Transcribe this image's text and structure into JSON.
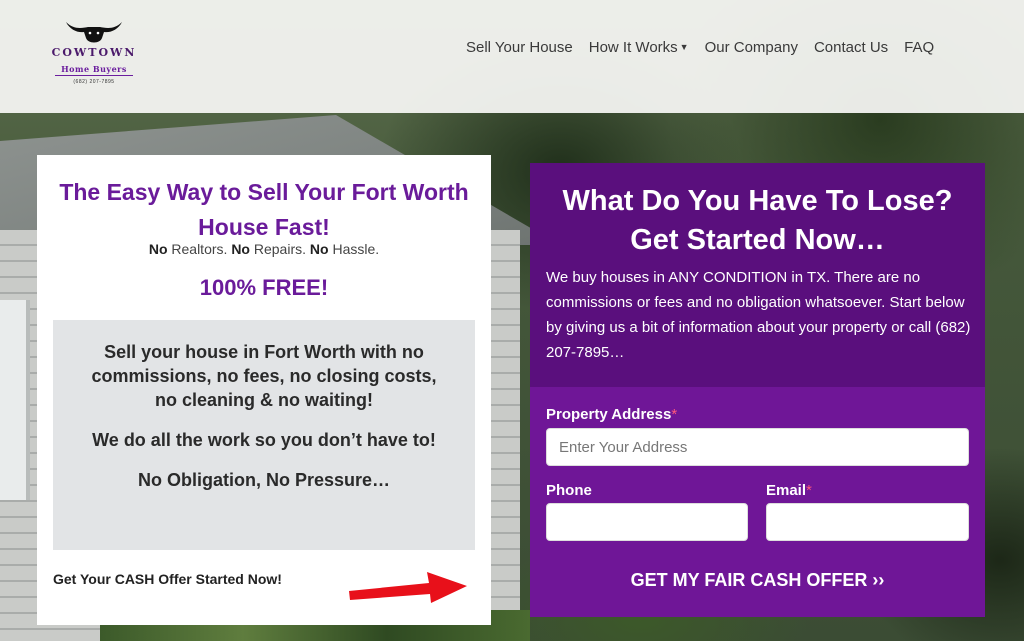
{
  "header": {
    "logo": {
      "name": "COWTOWN",
      "sub": "Home Buyers",
      "phone": "(682) 207-7895"
    },
    "nav": [
      {
        "label": "Sell Your House",
        "icon": ""
      },
      {
        "label": "How It Works",
        "icon": "caret-down-icon"
      },
      {
        "label": "Our Company",
        "icon": ""
      },
      {
        "label": "Contact Us",
        "icon": ""
      },
      {
        "label": "FAQ",
        "icon": ""
      }
    ]
  },
  "left_card": {
    "title": "The Easy Way to Sell Your Fort Worth House Fast!",
    "tagline": {
      "no1": "No",
      "t1": " Realtors. ",
      "no2": "No",
      "t2": " Repairs. ",
      "no3": "No",
      "t3": " Hassle."
    },
    "free": "100% FREE!",
    "box": [
      "Sell your house in Fort Worth with no commissions, no fees, no closing costs, no cleaning & no waiting!",
      "We do all the work so you don’t have to!",
      "No Obligation, No Pressure…"
    ],
    "cta": "Get Your CASH Offer Started Now!",
    "arrow_icon": "right-arrow-icon",
    "arrow_color": "#e8101a"
  },
  "form": {
    "title": "What Do You Have To Lose? Get Started Now…",
    "description": "We buy houses in ANY CONDITION in TX. There are no commissions or fees and no obligation whatsoever. Start below by giving us a bit of information about your property or call (682) 207-7895…",
    "address_label": "Property Address",
    "address_placeholder": "Enter Your Address",
    "address_value": "",
    "phone_label": "Phone",
    "phone_value": "",
    "email_label": "Email",
    "email_value": "",
    "required_mark": "*",
    "submit_label": "GET MY FAIR CASH OFFER ››",
    "colors": {
      "panel": "#6f1697",
      "panel_top": "#5a0f7d",
      "accent": "#6a1b9a"
    }
  }
}
